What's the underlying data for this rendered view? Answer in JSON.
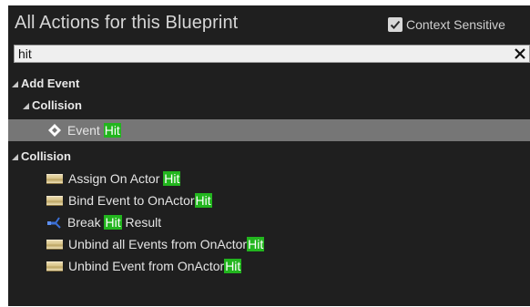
{
  "panel": {
    "title": "All Actions for this Blueprint",
    "context_sensitive": {
      "label": "Context Sensitive",
      "checked": true
    }
  },
  "search": {
    "value": "hit",
    "clear_icon": "close-icon"
  },
  "tree": {
    "add_event": {
      "label": "Add Event",
      "collision": {
        "label": "Collision",
        "items": [
          {
            "prefix": "Event ",
            "match": "Hit",
            "suffix": "",
            "icon": "event-diamond-icon",
            "selected": true
          }
        ]
      }
    },
    "collision": {
      "label": "Collision",
      "items": [
        {
          "prefix": "Assign On Actor ",
          "match": "Hit",
          "suffix": "",
          "icon": "function-icon"
        },
        {
          "prefix": "Bind Event to OnActor",
          "match": "Hit",
          "suffix": "",
          "icon": "function-icon"
        },
        {
          "prefix": "Break ",
          "match": "Hit",
          "suffix": " Result",
          "icon": "break-struct-icon"
        },
        {
          "prefix": "Unbind all Events from OnActor",
          "match": "Hit",
          "suffix": "",
          "icon": "function-icon"
        },
        {
          "prefix": "Unbind Event from OnActor",
          "match": "Hit",
          "suffix": "",
          "icon": "function-icon"
        }
      ]
    }
  },
  "colors": {
    "panel_bg": "#1f1f1f",
    "selected_row": "#767676",
    "match_highlight": "#22b51e"
  }
}
